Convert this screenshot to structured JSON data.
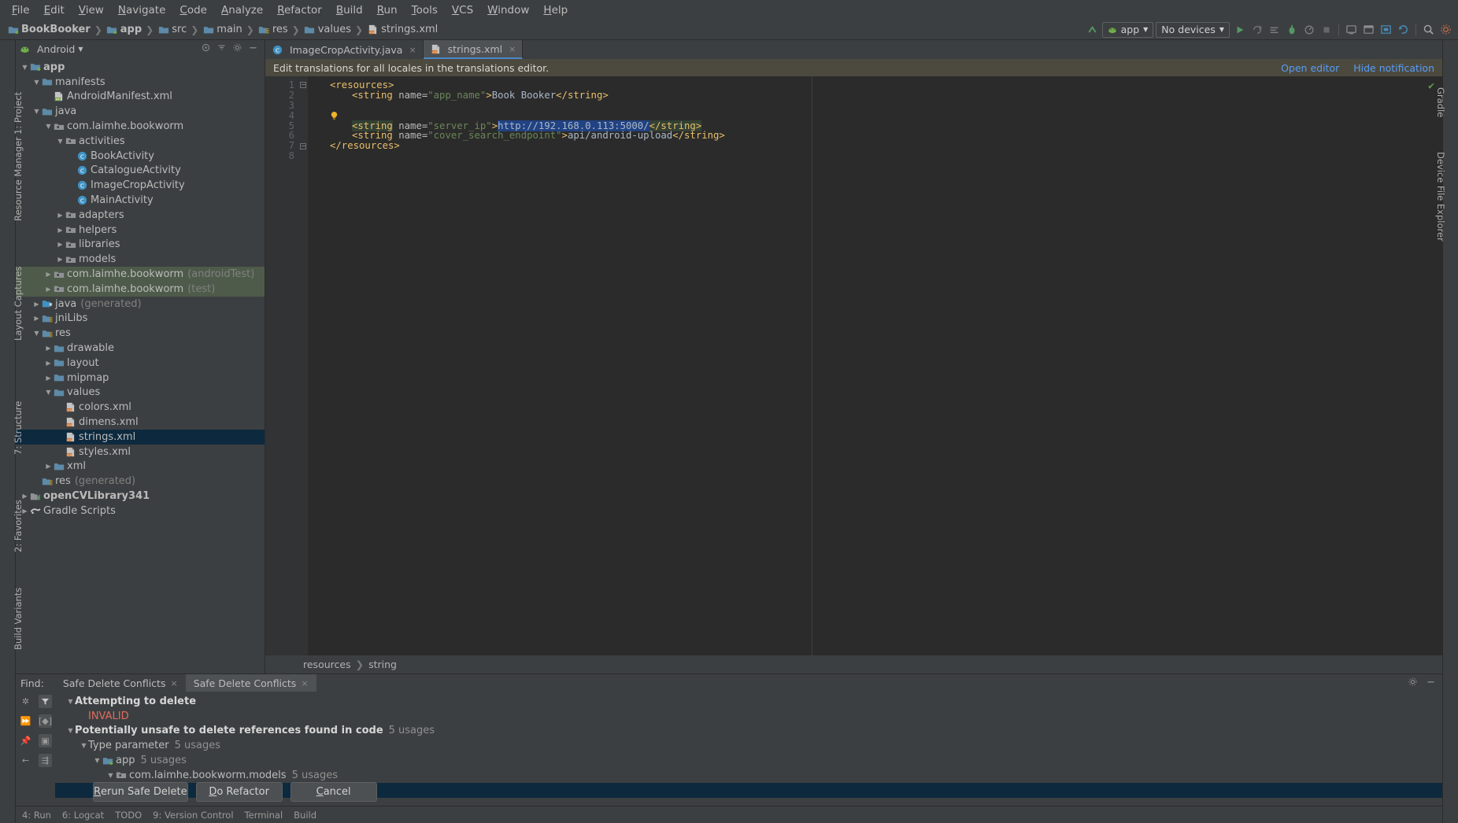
{
  "menubar": [
    "File",
    "Edit",
    "View",
    "Navigate",
    "Code",
    "Analyze",
    "Refactor",
    "Build",
    "Run",
    "Tools",
    "VCS",
    "Window",
    "Help"
  ],
  "breadcrumbs": [
    {
      "label": "BookBooker",
      "icon": "module-folder-icon",
      "bold": true
    },
    {
      "label": "app",
      "icon": "module-folder-icon",
      "bold": true
    },
    {
      "label": "src",
      "icon": "folder-icon",
      "bold": false
    },
    {
      "label": "main",
      "icon": "folder-icon",
      "bold": false
    },
    {
      "label": "res",
      "icon": "res-folder-icon",
      "bold": false
    },
    {
      "label": "values",
      "icon": "folder-icon",
      "bold": false
    },
    {
      "label": "strings.xml",
      "icon": "xml-file-icon",
      "bold": false
    }
  ],
  "toolbar": {
    "run_config": "app",
    "device": "No devices",
    "run_config_icon": "android-icon",
    "dropdown_icon": "chevron-down-icon",
    "buttons": [
      "make-project-icon",
      "run-icon",
      "apply-changes-icon",
      "apply-code-changes-icon",
      "debug-icon",
      "profile-icon",
      "stop-icon",
      "avd-manager-icon",
      "sdk-manager-icon",
      "layout-inspector-icon",
      "sync-gradle-icon",
      "attach-debugger-icon",
      "search-icon",
      "settings-icon"
    ]
  },
  "project_panel": {
    "title": "Android",
    "title_icon": "android-icon",
    "header_icons": [
      "target-icon",
      "collapse-all-icon",
      "settings-icon",
      "hide-icon"
    ],
    "tree": [
      {
        "indent": 0,
        "arrow": "▼",
        "icon": "module-folder-icon",
        "label": "app",
        "bold": true
      },
      {
        "indent": 1,
        "arrow": "▼",
        "icon": "folder-icon",
        "label": "manifests",
        "bold": false
      },
      {
        "indent": 2,
        "arrow": "",
        "icon": "manifest-file-icon",
        "label": "AndroidManifest.xml",
        "bold": false
      },
      {
        "indent": 1,
        "arrow": "▼",
        "icon": "folder-icon",
        "label": "java",
        "bold": false
      },
      {
        "indent": 2,
        "arrow": "▼",
        "icon": "package-icon",
        "label": "com.laimhe.bookworm",
        "bold": false
      },
      {
        "indent": 3,
        "arrow": "▼",
        "icon": "package-icon",
        "label": "activities",
        "bold": false
      },
      {
        "indent": 4,
        "arrow": "",
        "icon": "class-icon",
        "label": "BookActivity",
        "bold": false
      },
      {
        "indent": 4,
        "arrow": "",
        "icon": "class-icon",
        "label": "CatalogueActivity",
        "bold": false
      },
      {
        "indent": 4,
        "arrow": "",
        "icon": "class-icon",
        "label": "ImageCropActivity",
        "bold": false
      },
      {
        "indent": 4,
        "arrow": "",
        "icon": "class-icon",
        "label": "MainActivity",
        "bold": false
      },
      {
        "indent": 3,
        "arrow": "▶",
        "icon": "package-icon",
        "label": "adapters",
        "bold": false
      },
      {
        "indent": 3,
        "arrow": "▶",
        "icon": "package-icon",
        "label": "helpers",
        "bold": false
      },
      {
        "indent": 3,
        "arrow": "▶",
        "icon": "package-icon",
        "label": "libraries",
        "bold": false
      },
      {
        "indent": 3,
        "arrow": "▶",
        "icon": "package-icon",
        "label": "models",
        "bold": false
      },
      {
        "indent": 2,
        "arrow": "▶",
        "icon": "package-icon",
        "label": "com.laimhe.bookworm",
        "sublabel": "(androidTest)",
        "bold": false,
        "green": true
      },
      {
        "indent": 2,
        "arrow": "▶",
        "icon": "package-icon",
        "label": "com.laimhe.bookworm",
        "sublabel": "(test)",
        "bold": false,
        "green": true
      },
      {
        "indent": 1,
        "arrow": "▶",
        "icon": "generated-folder-icon",
        "label": "java",
        "sublabel": "(generated)",
        "bold": false
      },
      {
        "indent": 1,
        "arrow": "▶",
        "icon": "res-folder-icon",
        "label": "jniLibs",
        "bold": false
      },
      {
        "indent": 1,
        "arrow": "▼",
        "icon": "res-folder-icon",
        "label": "res",
        "bold": false
      },
      {
        "indent": 2,
        "arrow": "▶",
        "icon": "folder-icon",
        "label": "drawable",
        "bold": false
      },
      {
        "indent": 2,
        "arrow": "▶",
        "icon": "folder-icon",
        "label": "layout",
        "bold": false
      },
      {
        "indent": 2,
        "arrow": "▶",
        "icon": "folder-icon",
        "label": "mipmap",
        "bold": false
      },
      {
        "indent": 2,
        "arrow": "▼",
        "icon": "folder-icon",
        "label": "values",
        "bold": false
      },
      {
        "indent": 3,
        "arrow": "",
        "icon": "xml-file-icon",
        "label": "colors.xml",
        "bold": false
      },
      {
        "indent": 3,
        "arrow": "",
        "icon": "xml-file-icon",
        "label": "dimens.xml",
        "bold": false
      },
      {
        "indent": 3,
        "arrow": "",
        "icon": "xml-file-icon",
        "label": "strings.xml",
        "bold": false,
        "selected": true
      },
      {
        "indent": 3,
        "arrow": "",
        "icon": "xml-file-icon",
        "label": "styles.xml",
        "bold": false
      },
      {
        "indent": 2,
        "arrow": "▶",
        "icon": "folder-icon",
        "label": "xml",
        "bold": false
      },
      {
        "indent": 1,
        "arrow": "",
        "icon": "res-folder-icon",
        "label": "res",
        "sublabel": "(generated)",
        "bold": false
      },
      {
        "indent": 0,
        "arrow": "▶",
        "icon": "library-module-icon",
        "label": "openCVLibrary341",
        "bold": true
      },
      {
        "indent": 0,
        "arrow": "▶",
        "icon": "gradle-icon",
        "label": "Gradle Scripts",
        "bold": false
      }
    ]
  },
  "editor": {
    "tabs": [
      {
        "label": "ImageCropActivity.java",
        "icon": "class-icon",
        "active": false,
        "close": "×"
      },
      {
        "label": "strings.xml",
        "icon": "xml-file-icon",
        "active": true,
        "close": "×"
      }
    ],
    "notification": {
      "message": "Edit translations for all locales in the translations editor.",
      "open_editor": "Open editor",
      "hide_notification": "Hide notification"
    },
    "line_numbers": [
      "1",
      "2",
      "3",
      "4",
      "5",
      "6",
      "7",
      "8"
    ],
    "lines": [
      {
        "n": 1,
        "segments": [
          {
            "t": "<resources>",
            "c": "tag"
          }
        ],
        "indent": 0,
        "fold": "minus"
      },
      {
        "n": 2,
        "segments": [
          {
            "t": "<string",
            "c": "tag"
          },
          {
            "t": " name=",
            "c": "attr"
          },
          {
            "t": "\"app_name\"",
            "c": "aval"
          },
          {
            "t": ">",
            "c": "tag"
          },
          {
            "t": "Book Booker",
            "c": "txt"
          },
          {
            "t": "</string>",
            "c": "tag"
          }
        ],
        "indent": 1
      },
      {
        "n": 3,
        "segments": [],
        "indent": 0
      },
      {
        "n": 4,
        "segments": [],
        "indent": 0,
        "bulb": true
      },
      {
        "n": 5,
        "segments": [
          {
            "t": "<string",
            "c": "tag hl"
          },
          {
            "t": " name=",
            "c": "attr"
          },
          {
            "t": "\"server_ip\"",
            "c": "aval"
          },
          {
            "t": ">",
            "c": "tag"
          },
          {
            "t": "http://192.168.0.113:5000/",
            "c": "sel"
          },
          {
            "t": "</string>",
            "c": "tag hl"
          }
        ],
        "indent": 1
      },
      {
        "n": 6,
        "segments": [
          {
            "t": "<string",
            "c": "tag"
          },
          {
            "t": " name=",
            "c": "attr"
          },
          {
            "t": "\"cover_search_endpoint\"",
            "c": "aval"
          },
          {
            "t": ">",
            "c": "tag"
          },
          {
            "t": "api/android-upload",
            "c": "txt"
          },
          {
            "t": "</string>",
            "c": "tag"
          }
        ],
        "indent": 1
      },
      {
        "n": 7,
        "segments": [
          {
            "t": "</resources>",
            "c": "tag"
          }
        ],
        "indent": 0,
        "fold": "minus"
      },
      {
        "n": 8,
        "segments": [],
        "indent": 0
      }
    ],
    "status_breadcrumb": [
      "resources",
      "string"
    ],
    "inspection_status": "✔"
  },
  "find_panel": {
    "label": "Find:",
    "tabs": [
      {
        "label": "Safe Delete Conflicts",
        "active": false,
        "close": "×"
      },
      {
        "label": "Safe Delete Conflicts",
        "active": true,
        "close": "×"
      }
    ],
    "gutter_icons": [
      "settings-icon",
      "filter-icon",
      "expand-all-icon",
      "group-icon",
      "pin-icon",
      "preview-icon",
      "back-icon",
      "structure-icon"
    ],
    "rows": [
      {
        "indent": 0,
        "arrow": "▼",
        "label": "Attempting to delete",
        "bold": true
      },
      {
        "indent": 1,
        "arrow": "",
        "label": "INVALID",
        "red": true
      },
      {
        "indent": 0,
        "arrow": "▼",
        "label": "Potentially unsafe to delete references found in code",
        "bold": true,
        "usages": "5 usages"
      },
      {
        "indent": 1,
        "arrow": "▼",
        "label": "Type parameter",
        "usages": "5 usages"
      },
      {
        "indent": 2,
        "arrow": "▼",
        "icon": "module-folder-icon",
        "label": "app",
        "usages": "5 usages"
      },
      {
        "indent": 3,
        "arrow": "▼",
        "icon": "package-icon",
        "label": "com.laimhe.bookworm.models",
        "usages": "5 usages"
      },
      {
        "indent": 4,
        "arrow": "",
        "icon": "class-icon",
        "label": "",
        "selected": true
      }
    ],
    "buttons": [
      {
        "label": "Rerun Safe Delete",
        "mnemonic": "R"
      },
      {
        "label": "Do Refactor",
        "mnemonic": "D"
      },
      {
        "label": "Cancel",
        "mnemonic": "C"
      }
    ]
  },
  "left_strip_tabs": [
    {
      "label": "1: Project",
      "icon": "project-icon"
    },
    {
      "label": "Resource Manager",
      "icon": "resource-icon"
    },
    {
      "label": "Layout Captures",
      "icon": "capture-icon"
    },
    {
      "label": "7: Structure",
      "icon": "structure-icon"
    },
    {
      "label": "2: Favorites",
      "icon": "favorites-icon"
    },
    {
      "label": "Build Variants",
      "icon": "variants-icon"
    }
  ],
  "right_strip_tabs": [
    {
      "label": "Gradle",
      "icon": "gradle-icon"
    },
    {
      "label": "Device File Explorer",
      "icon": "device-icon"
    }
  ],
  "statusbar": {
    "items": [
      "4: Run",
      "6: Logcat",
      "TODO",
      "9: Version Control",
      "Terminal",
      "Build"
    ]
  },
  "colors": {
    "accent_blue": "#4a88c7",
    "selection_blue": "#214283",
    "tree_selection": "#0d293e",
    "notification_bg": "#4c4a3f",
    "link": "#589df6",
    "error_red": "#e06c5f",
    "string_green": "#6a8759",
    "tag_orange": "#e8bf6a"
  }
}
